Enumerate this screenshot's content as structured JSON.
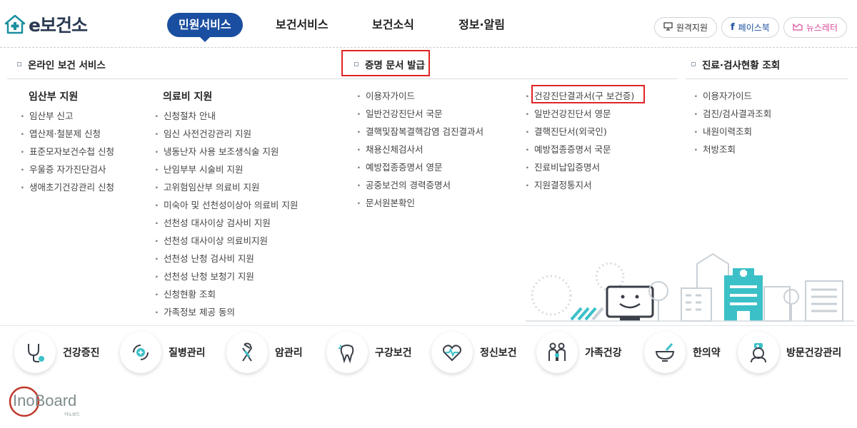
{
  "header": {
    "logo_text": "e보건소",
    "gnb": [
      "민원서비스",
      "보건서비스",
      "보건소식",
      "정보·알림"
    ],
    "util": {
      "remote": "원격지원",
      "facebook": "페이스북",
      "newsletter": "뉴스레터"
    }
  },
  "menu": {
    "online": {
      "title": "온라인 보건 서비스",
      "pregnancy": {
        "title": "임산부 지원",
        "items": [
          "임산부 신고",
          "엽산제·철분제 신청",
          "표준모자보건수첩 신청",
          "우울증 자가진단검사",
          "생애초기건강관리 신청"
        ]
      },
      "medical": {
        "title": "의료비 지원",
        "items": [
          "신청절차 안내",
          "임신 사전건강관리 지원",
          "냉동난자 사용 보조생식술 지원",
          "난임부부 시술비 지원",
          "고위험임산부 의료비 지원",
          "미숙아 및 선천성이상아 의료비 지원",
          "선천성 대사이상 검사비 지원",
          "선천성 대사이상 의료비지원",
          "선천성 난청 검사비 지원",
          "선천성 난청 보청기 지원",
          "신청현황 조회",
          "가족정보 제공 동의"
        ]
      }
    },
    "docs": {
      "title": "증명 문서 발급",
      "col1": [
        "이용자가이드",
        "일반건강진단서 국문",
        "결핵및잠복결핵감염 검진결과서",
        "채용신체검사서",
        "예방접종증명서 영문",
        "공중보건의 경력증명서",
        "문서원본확인"
      ],
      "col2": [
        "건강진단결과서(구 보건증)",
        "일반건강진단서 영문",
        "결핵진단서(외국인)",
        "예방접종증명서 국문",
        "진료비납입증명서",
        "지원결정통지서"
      ]
    },
    "inquiry": {
      "title": "진료·검사현황 조회",
      "items": [
        "이용자가이드",
        "검진/검사결과조회",
        "내원이력조회",
        "처방조회"
      ]
    }
  },
  "services": [
    {
      "label": "건강증진",
      "icon": "stethoscope-icon"
    },
    {
      "label": "질병관리",
      "icon": "disease-care-icon"
    },
    {
      "label": "암관리",
      "icon": "cancer-ribbon-icon"
    },
    {
      "label": "구강보건",
      "icon": "tooth-icon"
    },
    {
      "label": "정신보건",
      "icon": "heart-pulse-icon"
    },
    {
      "label": "가족건강",
      "icon": "family-icon"
    },
    {
      "label": "한의약",
      "icon": "mortar-icon"
    },
    {
      "label": "방문건강관리",
      "icon": "nurse-icon"
    }
  ],
  "watermark": {
    "main": "InoBoard",
    "sub": "이노보드"
  },
  "colors": {
    "primary": "#1a4ea0",
    "highlight_box": "#e02424",
    "accent_teal": "#3cc0c8",
    "newsletter": "#d94b9a"
  }
}
